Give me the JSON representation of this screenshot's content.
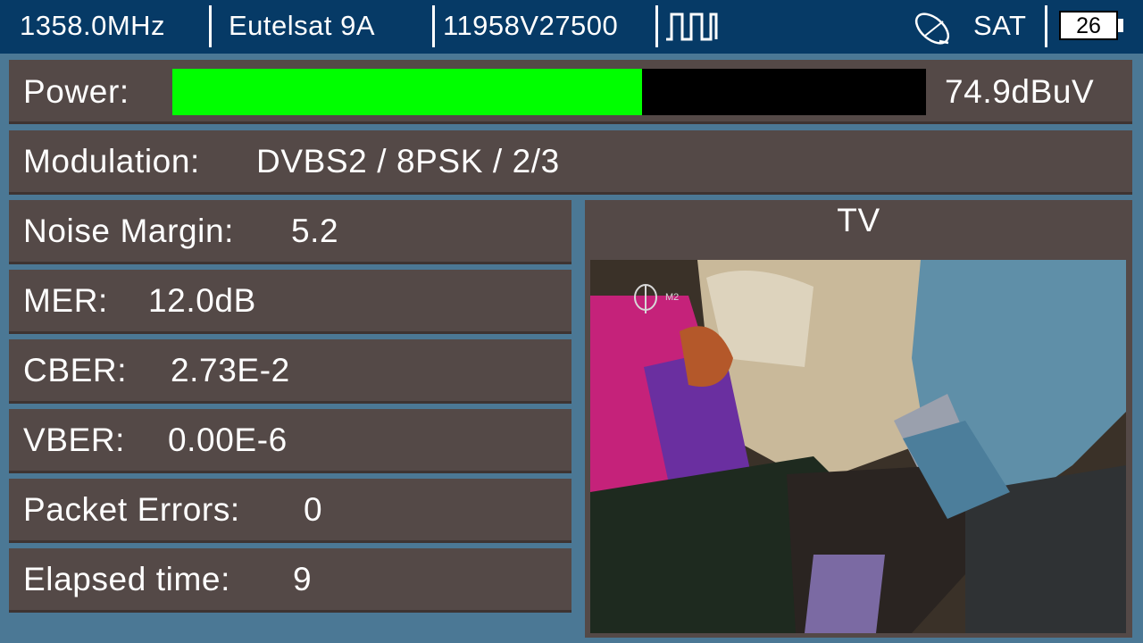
{
  "topbar": {
    "frequency": "1358.0MHz",
    "satellite": "Eutelsat 9A",
    "transponder": "11958V27500",
    "signal_icon": "square-wave-icon",
    "dish_icon": "satellite-dish-icon",
    "mode": "SAT",
    "battery": "26"
  },
  "power": {
    "label": "Power:",
    "value": "74.9dBuV",
    "fill_fraction": 0.623,
    "fill_color": "#00ff00"
  },
  "modulation": {
    "label": "Modulation:",
    "value": "DVBS2 / 8PSK / 2/3"
  },
  "metrics": [
    {
      "label": "Noise Margin:",
      "value": "5.2"
    },
    {
      "label": "MER:",
      "value": "12.0dB"
    },
    {
      "label": "CBER:",
      "value": "2.73E-2"
    },
    {
      "label": "VBER:",
      "value": "0.00E-6"
    },
    {
      "label": "Packet Errors:",
      "value": "0"
    },
    {
      "label": "Elapsed time:",
      "value": "9"
    }
  ],
  "tv": {
    "title": "TV",
    "channel_logo": "M2"
  },
  "colors": {
    "background": "#4b7895",
    "topbar": "#063a66",
    "panel": "#544947",
    "bar_empty": "#000000"
  }
}
